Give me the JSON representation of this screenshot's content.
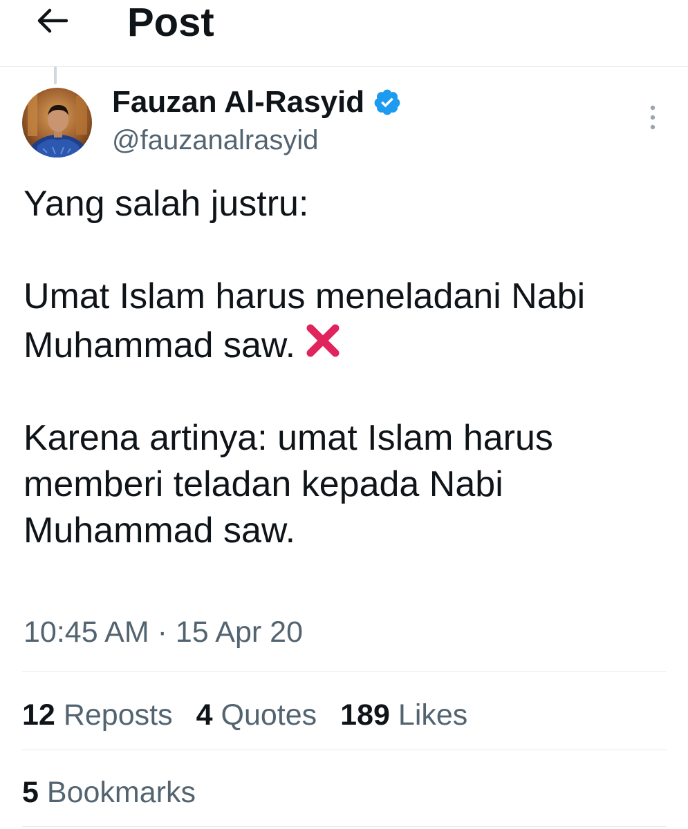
{
  "header": {
    "title": "Post",
    "back_icon": "arrow-left-icon"
  },
  "author": {
    "display_name": "Fauzan Al-Rasyid",
    "handle": "@fauzanalrasyid",
    "verified": true,
    "verified_color": "#1d9bf0"
  },
  "post": {
    "lines": [
      "Yang salah justru:",
      "",
      "Umat Islam harus meneladani Nabi",
      "Muhammad saw.",
      "",
      "Karena artinya: umat Islam harus",
      "memberi teladan kepada Nabi",
      "Muhammad saw."
    ],
    "emoji": "❌",
    "timestamp": "10:45 AM · 15 Apr 20"
  },
  "stats": {
    "reposts_count": "12",
    "reposts_label": "Reposts",
    "quotes_count": "4",
    "quotes_label": "Quotes",
    "likes_count": "189",
    "likes_label": "Likes",
    "bookmarks_count": "5",
    "bookmarks_label": "Bookmarks"
  },
  "colors": {
    "text_primary": "#0f1419",
    "text_secondary": "#536471",
    "divider": "#e6e9ec",
    "accent": "#1d9bf0",
    "cross": "#e0245e"
  }
}
